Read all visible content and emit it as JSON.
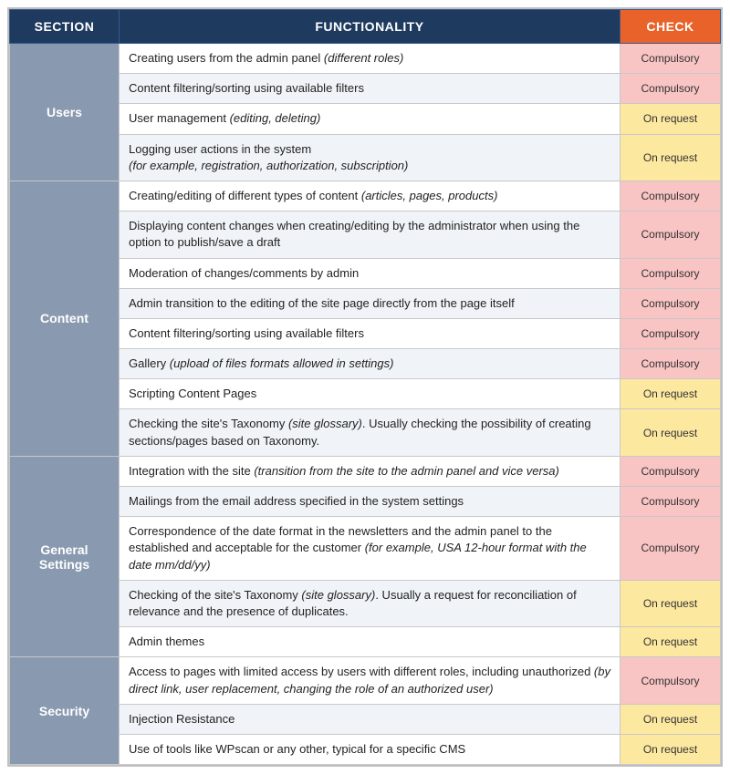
{
  "header": {
    "section_label": "SECTION",
    "functionality_label": "FUNCTIONALITY",
    "check_label": "CHECK"
  },
  "sections": [
    {
      "name": "Users",
      "rows": [
        {
          "functionality": "Creating users from the admin panel <em>(different roles)</em>",
          "check": "Compulsory",
          "check_type": "compulsory"
        },
        {
          "functionality": "Content filtering/sorting using available filters",
          "check": "Compulsory",
          "check_type": "compulsory"
        },
        {
          "functionality": "User management <em>(editing, deleting)</em>",
          "check": "On request",
          "check_type": "on-request"
        },
        {
          "functionality": "Logging user actions in the system<br><em>(for example, registration, authorization, subscription)</em>",
          "check": "On request",
          "check_type": "on-request"
        }
      ]
    },
    {
      "name": "Content",
      "rows": [
        {
          "functionality": "Creating/editing of different types of content <em>(articles, pages, products)</em>",
          "check": "Compulsory",
          "check_type": "compulsory"
        },
        {
          "functionality": "Displaying content changes when creating/editing by the administrator when using the option to publish/save a draft",
          "check": "Compulsory",
          "check_type": "compulsory"
        },
        {
          "functionality": "Moderation of changes/comments by admin",
          "check": "Compulsory",
          "check_type": "compulsory"
        },
        {
          "functionality": "Admin transition to the editing of the site page directly from the page itself",
          "check": "Compulsory",
          "check_type": "compulsory"
        },
        {
          "functionality": "Content filtering/sorting using available filters",
          "check": "Compulsory",
          "check_type": "compulsory"
        },
        {
          "functionality": "Gallery <em>(upload of files formats allowed in settings)</em>",
          "check": "Compulsory",
          "check_type": "compulsory"
        },
        {
          "functionality": "Scripting Content Pages",
          "check": "On request",
          "check_type": "on-request"
        },
        {
          "functionality": "Checking the site's Taxonomy <em>(site glossary)</em>. Usually checking the possibility of creating sections/pages based on Taxonomy.",
          "check": "On request",
          "check_type": "on-request"
        }
      ]
    },
    {
      "name": "General\nSettings",
      "rows": [
        {
          "functionality": "Integration with the site <em>(transition from the site to the admin panel and vice versa)</em>",
          "check": "Compulsory",
          "check_type": "compulsory"
        },
        {
          "functionality": "Mailings from the email address specified in the system settings",
          "check": "Compulsory",
          "check_type": "compulsory"
        },
        {
          "functionality": "Correspondence of the date format in the newsletters and the admin panel to the established and acceptable for the customer <em>(for example, USA 12-hour format with the date mm/dd/yy)</em>",
          "check": "Compulsory",
          "check_type": "compulsory"
        },
        {
          "functionality": "Checking of the site's Taxonomy <em>(site glossary)</em>.  Usually a request for reconciliation of relevance and the presence of duplicates.",
          "check": "On request",
          "check_type": "on-request"
        },
        {
          "functionality": "Admin themes",
          "check": "On request",
          "check_type": "on-request"
        }
      ]
    },
    {
      "name": "Security",
      "rows": [
        {
          "functionality": "Access to pages with limited access by users with different roles, including unauthorized <em>(by direct link, user replacement, changing the role of an authorized user)</em>",
          "check": "Compulsory",
          "check_type": "compulsory"
        },
        {
          "functionality": "Injection Resistance",
          "check": "On request",
          "check_type": "on-request"
        },
        {
          "functionality": "Use of tools like WPscan or any other, typical for a specific CMS",
          "check": "On request",
          "check_type": "on-request"
        }
      ]
    }
  ]
}
